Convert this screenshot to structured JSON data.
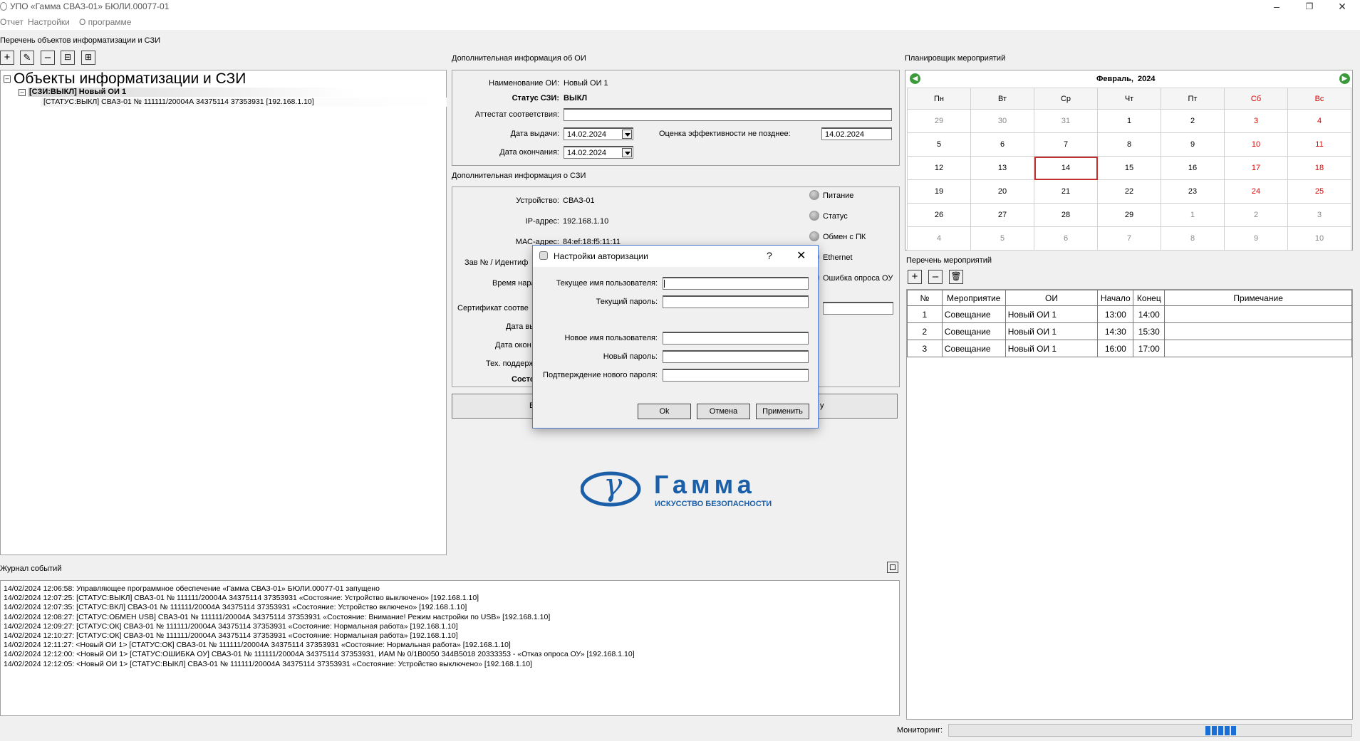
{
  "window": {
    "title": "УПО «Гамма СВАЗ-01» БЮЛИ.00077-01"
  },
  "menu": {
    "items": [
      "Отчет",
      "Настройки",
      "О программе"
    ]
  },
  "objects_panel": {
    "label": "Перечень объектов информатизации и СЗИ",
    "tree_root": "Объекты информатизации и СЗИ",
    "tree_oi": "[СЗИ:ВЫКЛ] Новый ОИ 1",
    "tree_device": "[СТАТУС:ВЫКЛ] СВАЗ-01 № 111111/20004А 34375114 37353931 [192.168.1.10]"
  },
  "oi_info": {
    "label": "Дополнительная информация об ОИ",
    "name_label": "Наименование ОИ:",
    "name_value": "Новый ОИ 1",
    "szi_status_label": "Статус СЗИ:",
    "szi_status_value": "ВЫКЛ",
    "attestat_label": "Аттестат соответствия:",
    "attestat_value": "",
    "issue_date_label": "Дата выдачи:",
    "issue_date_value": "14.02.2024",
    "efficiency_label": "Оценка эффективности не позднее:",
    "efficiency_value": "14.02.2024",
    "end_date_label": "Дата окончания:",
    "end_date_value": "14.02.2024"
  },
  "szi_info": {
    "label": "Дополнительная информация о СЗИ",
    "device_label": "Устройство:",
    "device_value": "СВАЗ-01",
    "ip_label": "IP-адрес:",
    "ip_value": "192.168.1.10",
    "mac_label": "МАС-адрес:",
    "mac_value": "84:ef:18:f5:11:11",
    "serial_label": "Зав № / Идентиф",
    "runtime_label": "Время нара",
    "cert_label": "Сертификат соотве",
    "issue_label": "Дата вы",
    "end_label": "Дата окон",
    "support_label": "Тех. поддерж",
    "status_label": "Состо",
    "indicators": [
      "Питание",
      "Статус",
      "Обмен с ПК",
      "Ethernet",
      "Ошибка опроса ОУ"
    ],
    "btn_left": "В",
    "btn_right": "у"
  },
  "logo": {
    "name": "Гамма",
    "tagline": "ИСКУССТВО БЕЗОПАСНОСТИ",
    "symbol": "γ"
  },
  "planner": {
    "label": "Планировщик мероприятий",
    "month": "Февраль,",
    "year": "2024",
    "weekdays": [
      "Пн",
      "Вт",
      "Ср",
      "Чт",
      "Пт",
      "Сб",
      "Вс"
    ],
    "weeks": [
      [
        "29",
        "30",
        "31",
        "1",
        "2",
        "3",
        "4"
      ],
      [
        "5",
        "6",
        "7",
        "8",
        "9",
        "10",
        "11"
      ],
      [
        "12",
        "13",
        "14",
        "15",
        "16",
        "17",
        "18"
      ],
      [
        "19",
        "20",
        "21",
        "22",
        "23",
        "24",
        "25"
      ],
      [
        "26",
        "27",
        "28",
        "29",
        "1",
        "2",
        "3"
      ],
      [
        "4",
        "5",
        "6",
        "7",
        "8",
        "9",
        "10"
      ]
    ],
    "today": "14",
    "events_label": "Перечень мероприятий",
    "columns": [
      "№",
      "Мероприятие",
      "ОИ",
      "Начало",
      "Конец",
      "Примечание"
    ],
    "events": [
      [
        "1",
        "Совещание",
        "Новый ОИ 1",
        "13:00",
        "14:00",
        ""
      ],
      [
        "2",
        "Совещание",
        "Новый ОИ 1",
        "14:30",
        "15:30",
        ""
      ],
      [
        "3",
        "Совещание",
        "Новый ОИ 1",
        "16:00",
        "17:00",
        ""
      ]
    ]
  },
  "log": {
    "label": "Журнал событий",
    "lines": [
      "14/02/2024 12:06:58: Управляющее программное обеспечение «Гамма СВАЗ-01» БЮЛИ.00077-01 запущено",
      "14/02/2024 12:07:25: [СТАТУС:ВЫКЛ] СВАЗ-01 № 111111/20004А 34375114 37353931 «Состояние: Устройство выключено» [192.168.1.10]",
      "14/02/2024 12:07:35: [СТАТУС:ВКЛ] СВАЗ-01 № 111111/20004А 34375114 37353931 «Состояние: Устройство включено» [192.168.1.10]",
      "14/02/2024 12:08:27: [СТАТУС:ОБМЕН USB] СВАЗ-01 № 111111/20004А 34375114 37353931 «Состояние: Внимание! Режим настройки по USB» [192.168.1.10]",
      "14/02/2024 12:09:27: [СТАТУС:ОК] СВАЗ-01 № 111111/20004А 34375114 37353931 «Состояние: Нормальная работа» [192.168.1.10]",
      "14/02/2024 12:10:27: [СТАТУС:ОК] СВАЗ-01 № 111111/20004А 34375114 37353931 «Состояние: Нормальная работа» [192.168.1.10]",
      "14/02/2024 12:11:27: <Новый ОИ 1> [СТАТУС:ОК] СВАЗ-01 № 111111/20004А 34375114 37353931 «Состояние: Нормальная работа» [192.168.1.10]",
      "14/02/2024 12:12:00: <Новый ОИ 1> [СТАТУС:ОШИБКА ОУ] СВАЗ-01 № 111111/20004А 34375114 37353931, ИАМ № 0/1В0050 344В5018 20333353 - «Отказ опроса ОУ» [192.168.1.10]",
      "14/02/2024 12:12:05: <Новый ОИ 1> [СТАТУС:ВЫКЛ] СВАЗ-01 № 111111/20004А 34375114 37353931 «Состояние: Устройство выключено» [192.168.1.10]"
    ]
  },
  "status": {
    "monitoring_label": "Мониторинг:"
  },
  "auth_dialog": {
    "title": "Настройки авторизации",
    "help": "?",
    "current_user_label": "Текущее имя пользователя:",
    "current_user_value": "",
    "current_pass_label": "Текущий пароль:",
    "new_user_label": "Новое имя пользователя:",
    "new_pass_label": "Новый пароль:",
    "confirm_pass_label": "Подтверждение нового пароля:",
    "ok": "Ok",
    "cancel": "Отмена",
    "apply": "Применить"
  },
  "colors": {
    "weekend": "#e00000",
    "today_border": "#c03030",
    "dialog_border": "#4a7bd0",
    "logo_blue": "#1b5fa8"
  }
}
